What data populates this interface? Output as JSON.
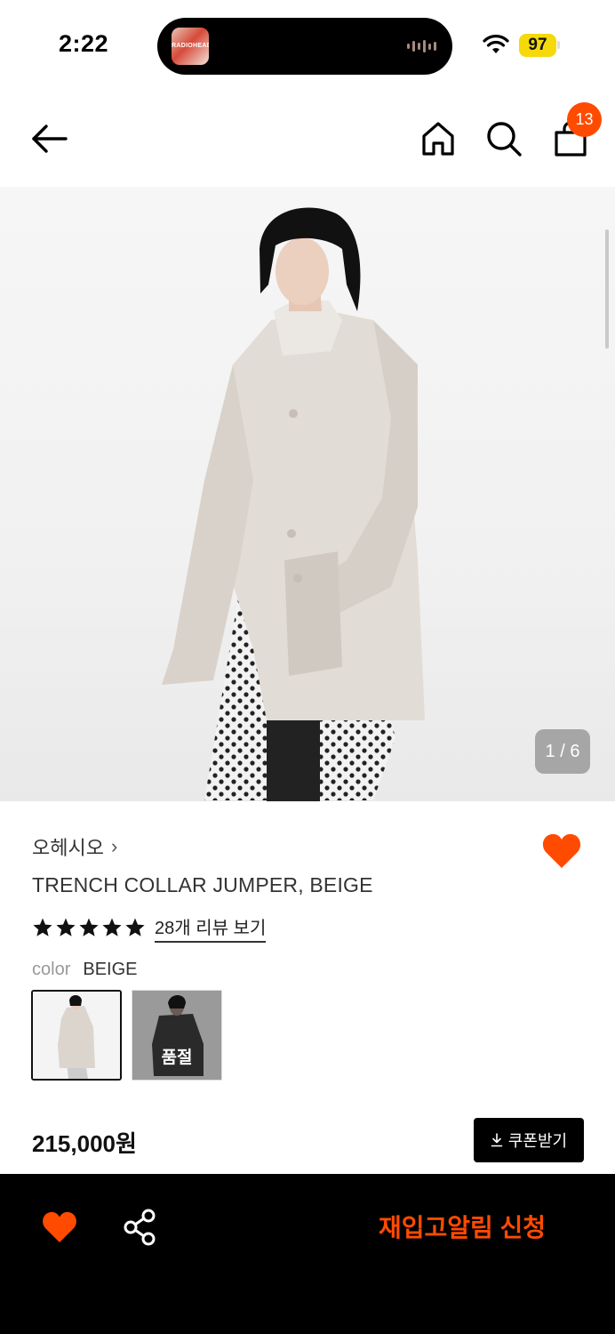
{
  "status_bar": {
    "time": "2:22",
    "now_playing_art_text": "RADIOHEAD",
    "battery": "97"
  },
  "header": {
    "cart_count": "13"
  },
  "gallery": {
    "counter": "1 / 6"
  },
  "product": {
    "brand": "오헤시오",
    "brand_chevron": "›",
    "name": "TRENCH COLLAR JUMPER, BEIGE",
    "rating_stars": 5,
    "review_link": "28개 리뷰 보기",
    "color_label": "color",
    "color_value": "BEIGE",
    "swatches": [
      {
        "name": "beige",
        "selected": true,
        "badge": ""
      },
      {
        "name": "black",
        "selected": false,
        "badge": "품절"
      }
    ],
    "price": "215,000원",
    "coupon_button": "쿠폰받기"
  },
  "bottom_bar": {
    "restock_button": "재입고알림 신청"
  },
  "colors": {
    "accent": "#ff4b00",
    "battery": "#f5d90a",
    "text": "#111111",
    "bottom_bar": "#000000"
  }
}
